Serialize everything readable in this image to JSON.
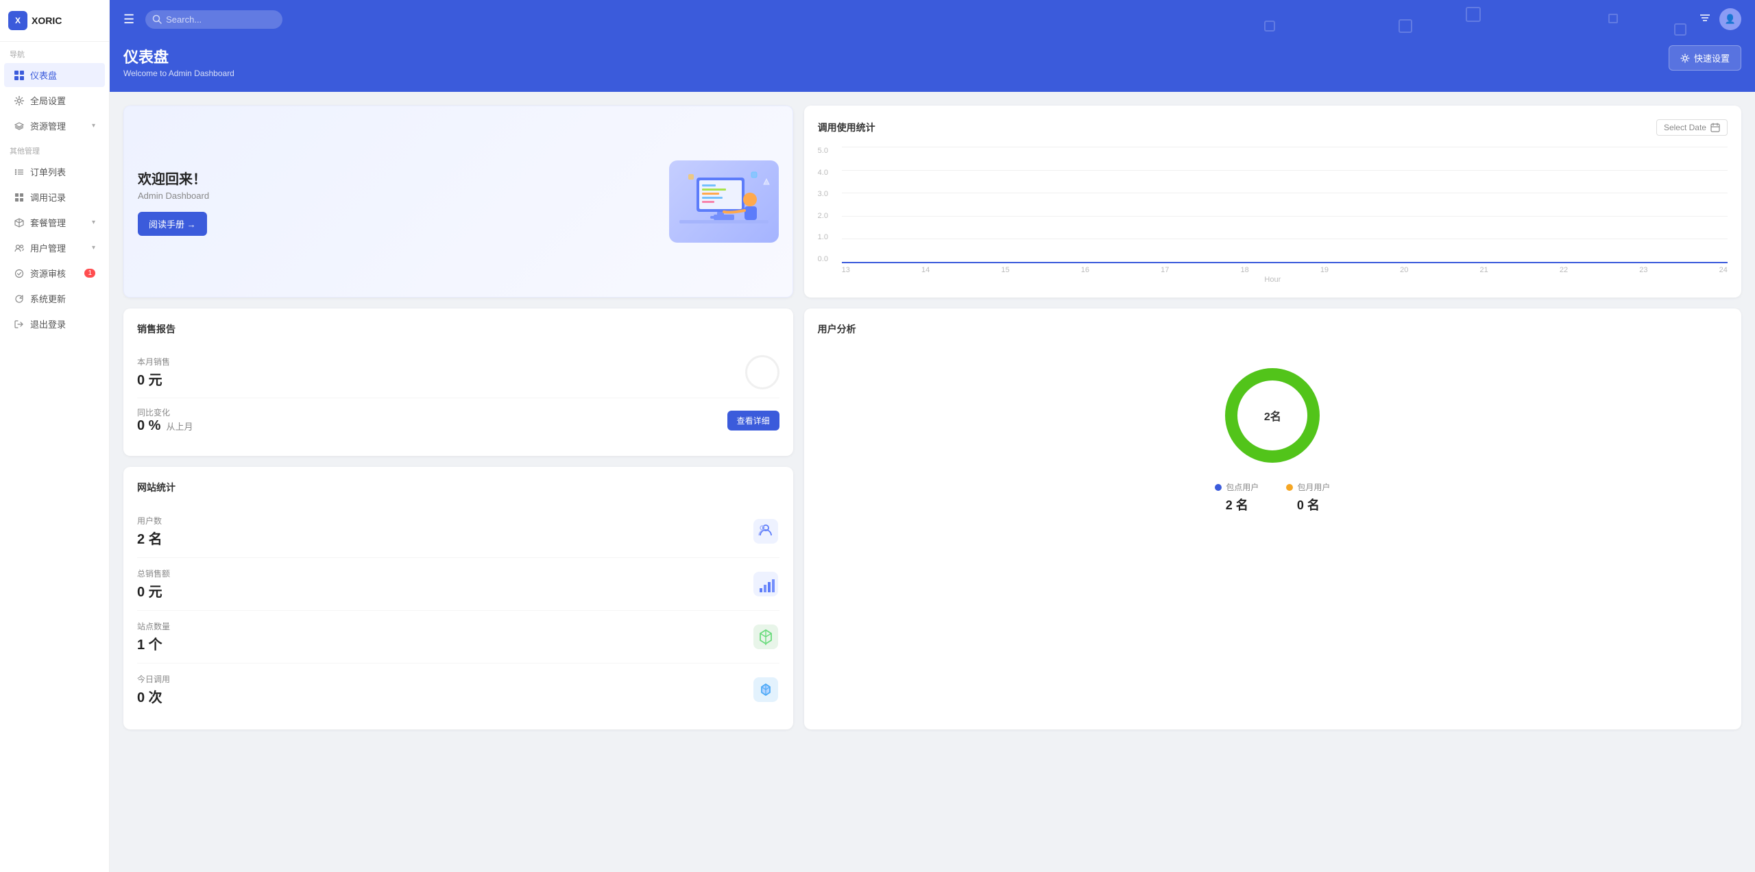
{
  "logo": {
    "icon": "X",
    "text": "XORIC"
  },
  "sidebar": {
    "nav_label": "导航",
    "items": [
      {
        "id": "dashboard",
        "label": "仪表盘",
        "active": true,
        "icon": "grid"
      },
      {
        "id": "global-settings",
        "label": "全局设置",
        "icon": "settings"
      },
      {
        "id": "resource-management",
        "label": "资源管理",
        "icon": "layers",
        "hasChevron": true
      }
    ],
    "other_label": "其他管理",
    "other_items": [
      {
        "id": "order-list",
        "label": "订单列表",
        "icon": "list"
      },
      {
        "id": "call-records",
        "label": "调用记录",
        "icon": "grid2"
      },
      {
        "id": "package-management",
        "label": "套餐管理",
        "icon": "package",
        "hasChevron": true
      },
      {
        "id": "user-management",
        "label": "用户管理",
        "icon": "users",
        "hasChevron": true
      },
      {
        "id": "resource-audit",
        "label": "资源审核",
        "icon": "check-circle",
        "badge": "1"
      },
      {
        "id": "system-update",
        "label": "系统更新",
        "icon": "refresh"
      },
      {
        "id": "logout",
        "label": "退出登录",
        "icon": "logout"
      }
    ]
  },
  "header": {
    "search_placeholder": "Search...",
    "quick_setup_label": "快速设置"
  },
  "page": {
    "title": "仪表盘",
    "subtitle": "Welcome to Admin Dashboard"
  },
  "welcome_card": {
    "title": "欢迎回来！",
    "subtitle": "Admin Dashboard",
    "button_label": "阅读手册 →"
  },
  "chart": {
    "title": "调用使用统计",
    "date_picker_placeholder": "Select Date",
    "y_axis": [
      "5.0",
      "4.0",
      "3.0",
      "2.0",
      "1.0",
      "0.0"
    ],
    "x_axis": [
      "13",
      "14",
      "15",
      "16",
      "17",
      "18",
      "19",
      "20",
      "21",
      "22",
      "23",
      "24"
    ],
    "x_label": "Hour"
  },
  "sales_report": {
    "title": "销售报告",
    "monthly_label": "本月销售",
    "monthly_value": "0 元",
    "change_label": "同比变化",
    "change_value": "0 %",
    "change_suffix": "从上月",
    "detail_btn_label": "查看详细"
  },
  "site_stats": {
    "title": "网站统计",
    "items": [
      {
        "label": "用户数",
        "value": "2 名",
        "icon": "layers-icon"
      },
      {
        "label": "总销售额",
        "value": "0 元",
        "icon": "bar-chart-icon"
      },
      {
        "label": "站点数量",
        "value": "1 个",
        "icon": "bookmark-icon"
      },
      {
        "label": "今日调用",
        "value": "0 次",
        "icon": "cube-icon"
      }
    ]
  },
  "user_analysis": {
    "title": "用户分析",
    "donut_center": "2名",
    "legend": [
      {
        "label": "包点用户",
        "value": "2 名",
        "color": "#3b5bdb"
      },
      {
        "label": "包月用户",
        "value": "0 名",
        "color": "#f5a623"
      }
    ]
  },
  "colors": {
    "primary": "#3b5bdb",
    "green": "#52c41a",
    "orange": "#f5a623",
    "red": "#ff4d4f"
  }
}
